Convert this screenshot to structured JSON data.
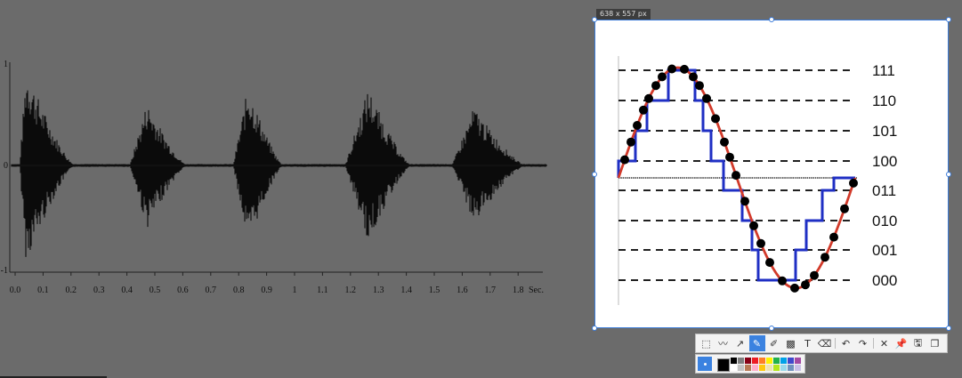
{
  "screenshot_tool": {
    "size_label": "638 x 557  px",
    "toolbar": [
      {
        "name": "rectangle-tool-icon",
        "glyph": "⬚"
      },
      {
        "name": "curve-tool-icon",
        "glyph": "〰"
      },
      {
        "name": "arrow-tool-icon",
        "glyph": "↗"
      },
      {
        "name": "pen-tool-icon",
        "glyph": "✎",
        "active": true
      },
      {
        "name": "marker-tool-icon",
        "glyph": "✐"
      },
      {
        "name": "mosaic-tool-icon",
        "glyph": "▩"
      },
      {
        "name": "text-tool-icon",
        "glyph": "T"
      },
      {
        "name": "eraser-tool-icon",
        "glyph": "⌫"
      },
      {
        "sep": true
      },
      {
        "name": "undo-icon",
        "glyph": "↶"
      },
      {
        "name": "redo-icon",
        "glyph": "↷"
      },
      {
        "sep": true
      },
      {
        "name": "cancel-icon",
        "glyph": "✕"
      },
      {
        "name": "pin-icon",
        "glyph": "📌"
      },
      {
        "name": "save-icon",
        "glyph": "🖫"
      },
      {
        "name": "copy-icon",
        "glyph": "❐"
      }
    ],
    "current_color": "#000000",
    "palette": [
      "#000000",
      "#7f7f7f",
      "#880015",
      "#ed1c24",
      "#ff7f27",
      "#fff200",
      "#22b14c",
      "#00a2e8",
      "#3f48cc",
      "#a349a4",
      "#ffffff",
      "#c3c3c3",
      "#b97a57",
      "#ffaec9",
      "#ffc90e",
      "#efe4b0",
      "#b5e61d",
      "#99d9ea",
      "#7092be",
      "#c8bfe7"
    ]
  },
  "waveform": {
    "y_ticks": [
      "1",
      "0",
      "-1"
    ],
    "x_ticks": [
      "0.0",
      "0.1",
      "0.2",
      "0.3",
      "0.4",
      "0.5",
      "0.6",
      "0.7",
      "0.8",
      "0.9",
      "1",
      "1.1",
      "1.2",
      "1.3",
      "1.4",
      "1.5",
      "1.6",
      "1.7",
      "1.8"
    ],
    "x_unit": "Sec."
  },
  "quantization": {
    "levels": [
      "111",
      "110",
      "101",
      "100",
      "011",
      "010",
      "001",
      "000"
    ],
    "colors": {
      "sine": "#d23a2a",
      "staircase": "#1f2fc4",
      "samples": "#000000",
      "dashes": "#000000"
    }
  }
}
